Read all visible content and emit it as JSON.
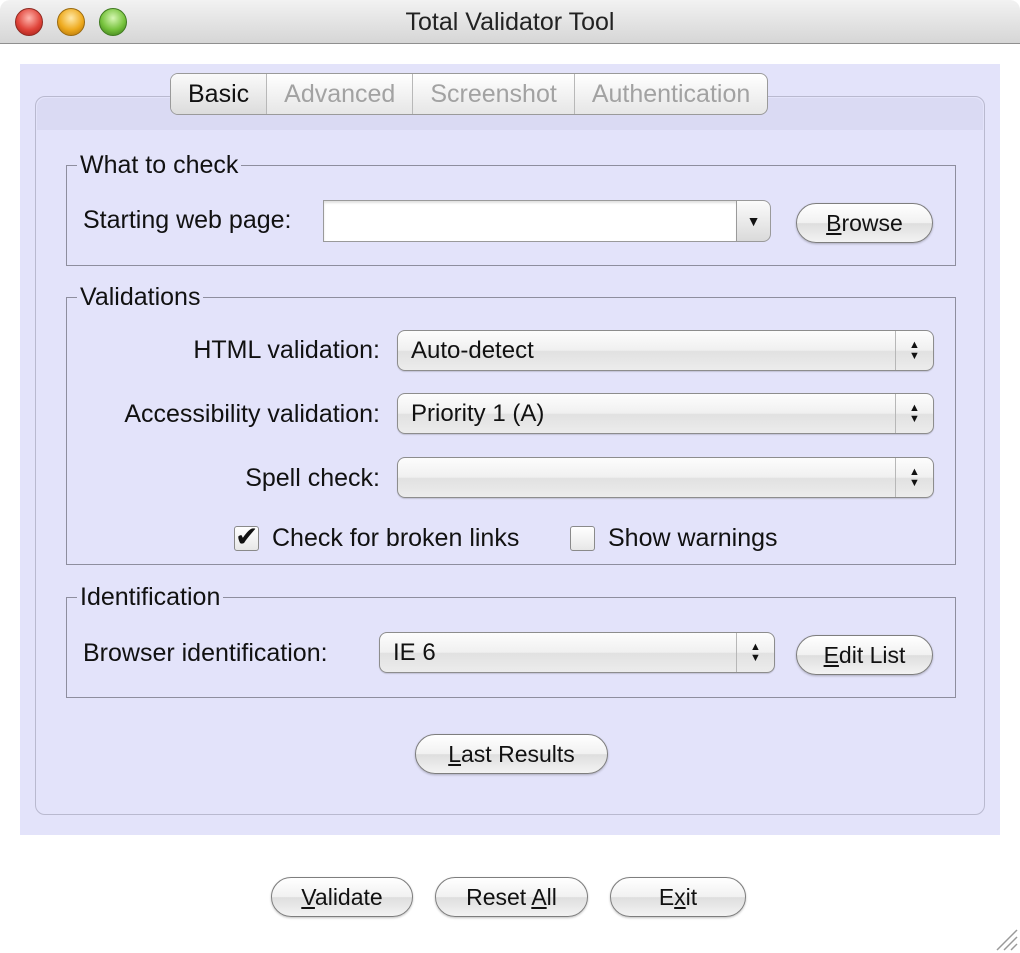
{
  "window": {
    "title": "Total Validator Tool"
  },
  "tabs": [
    {
      "label": "Basic",
      "active": true
    },
    {
      "label": "Advanced",
      "active": false
    },
    {
      "label": "Screenshot",
      "active": false
    },
    {
      "label": "Authentication",
      "active": false
    }
  ],
  "what_to_check": {
    "legend": "What to check",
    "starting_page_label": "Starting web page:",
    "starting_page_value": "",
    "browse_button": {
      "mnemonic": "B",
      "rest": "rowse"
    }
  },
  "validations": {
    "legend": "Validations",
    "html_label": "HTML validation:",
    "html_value": "Auto-detect",
    "accessibility_label": "Accessibility validation:",
    "accessibility_value": "Priority 1 (A)",
    "spell_label": "Spell check:",
    "spell_value": "",
    "broken_links_label": "Check for broken links",
    "broken_links_checked": true,
    "show_warnings_label": "Show warnings",
    "show_warnings_checked": false
  },
  "identification": {
    "legend": "Identification",
    "browser_label": "Browser identification:",
    "browser_value": "IE 6",
    "edit_list_button": {
      "mnemonic": "E",
      "rest": "dit List"
    }
  },
  "last_results_button": {
    "mnemonic": "L",
    "rest": "ast Results"
  },
  "footer": {
    "validate_button": {
      "mnemonic": "V",
      "rest": "alidate"
    },
    "reset_all_button": {
      "before": "Reset ",
      "mnemonic": "A",
      "rest": "ll"
    },
    "exit_button": {
      "before": "E",
      "mnemonic": "x",
      "rest": "it"
    }
  },
  "icons": {
    "checkmark": "✔",
    "combo_down": "▼",
    "stepper_up": "▲",
    "stepper_down": "▼"
  }
}
